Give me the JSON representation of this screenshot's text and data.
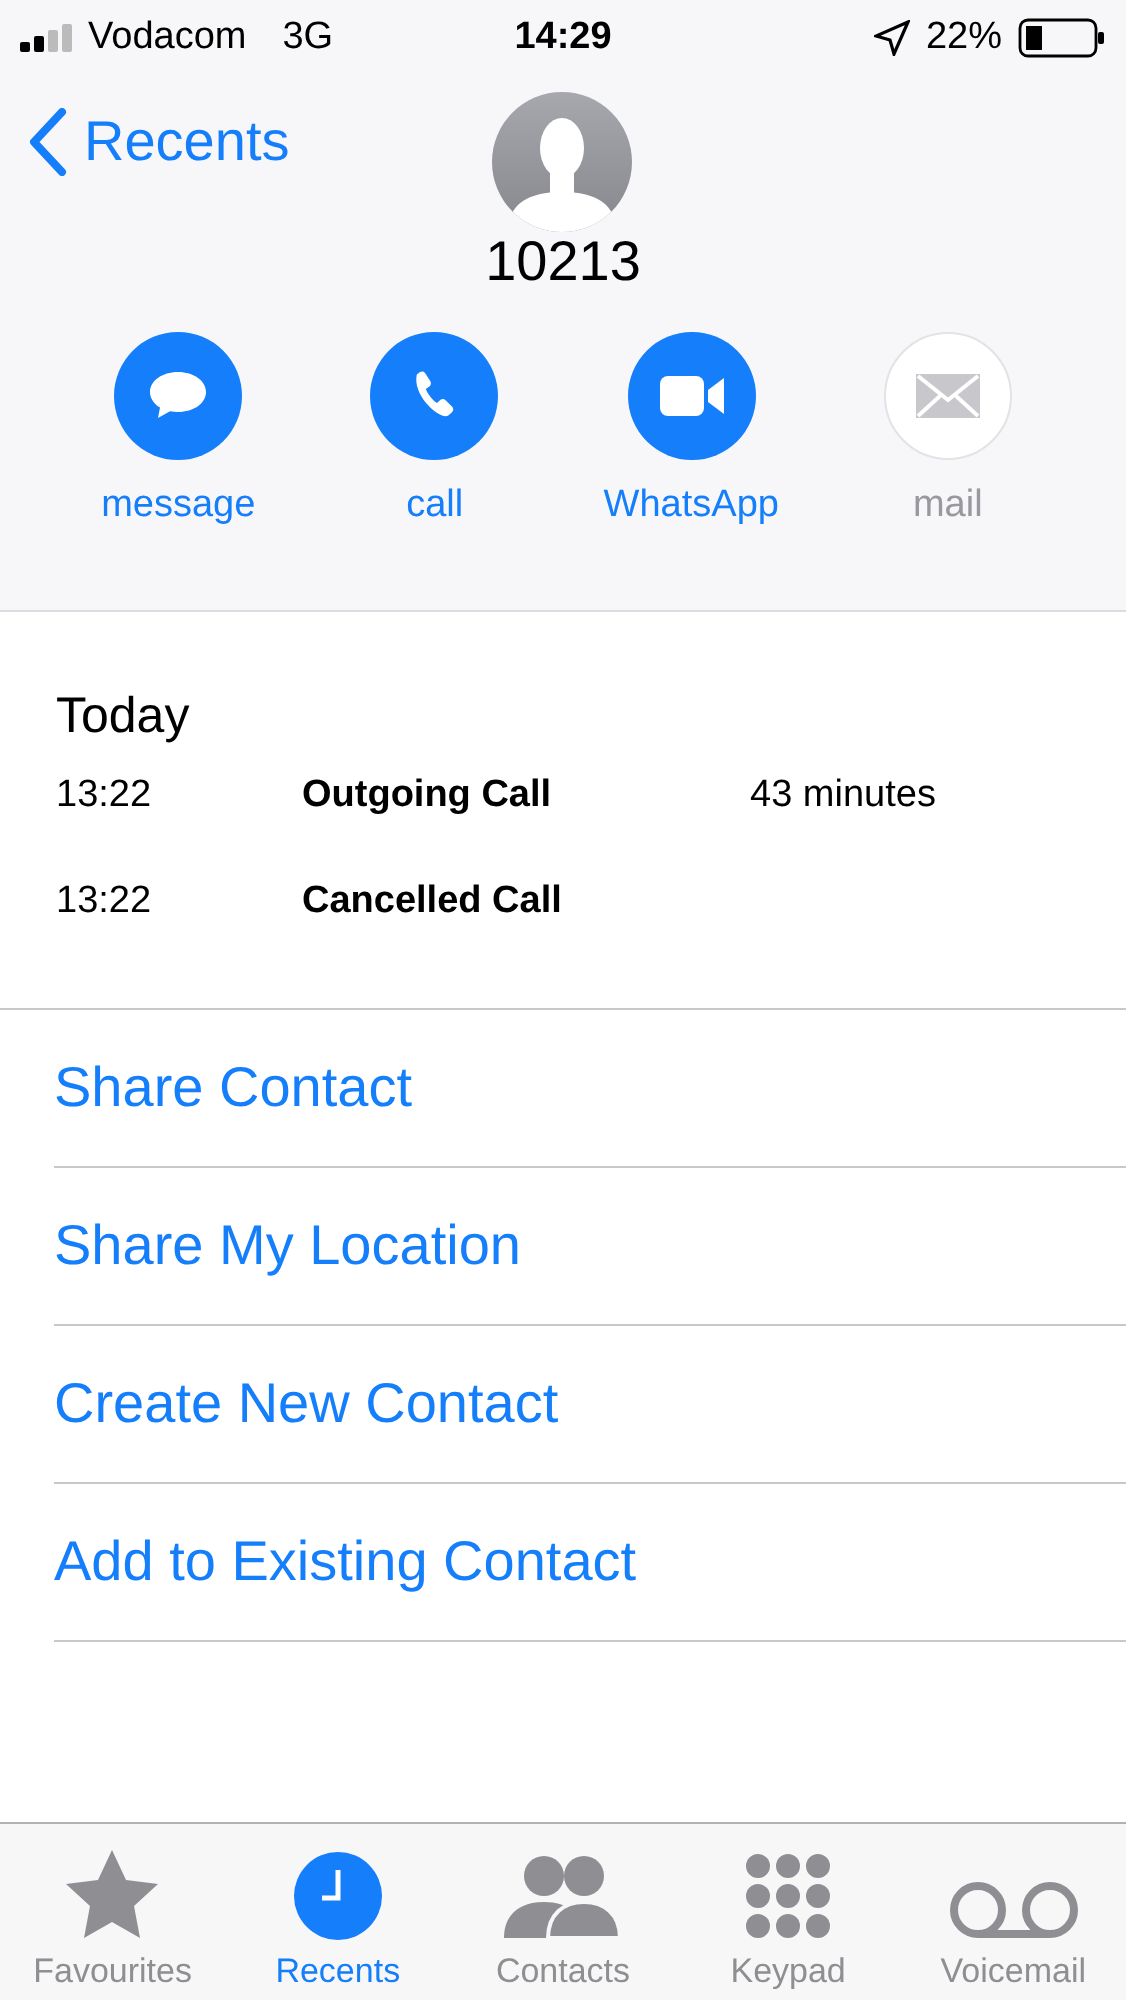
{
  "status_bar": {
    "carrier": "Vodacom",
    "network": "3G",
    "time": "14:29",
    "battery_percent": "22%"
  },
  "nav": {
    "back_label": "Recents"
  },
  "contact": {
    "name": "10213"
  },
  "actions": [
    {
      "kind": "message",
      "label": "message",
      "disabled": false
    },
    {
      "kind": "call",
      "label": "call",
      "disabled": false
    },
    {
      "kind": "video",
      "label": "WhatsApp",
      "disabled": false
    },
    {
      "kind": "mail",
      "label": "mail",
      "disabled": true
    }
  ],
  "history": {
    "heading": "Today",
    "calls": [
      {
        "time": "13:22",
        "type": "Outgoing Call",
        "duration": "43 minutes"
      },
      {
        "time": "13:22",
        "type": "Cancelled Call"
      }
    ]
  },
  "links": [
    "Share Contact",
    "Share My Location",
    "Create New Contact",
    "Add to Existing Contact"
  ],
  "tabs": [
    {
      "kind": "star",
      "label": "Favourites",
      "selected": false
    },
    {
      "kind": "clock",
      "label": "Recents",
      "selected": true
    },
    {
      "kind": "people",
      "label": "Contacts",
      "selected": false
    },
    {
      "kind": "keypad",
      "label": "Keypad",
      "selected": false
    },
    {
      "kind": "voicemail",
      "label": "Voicemail",
      "selected": false
    }
  ]
}
